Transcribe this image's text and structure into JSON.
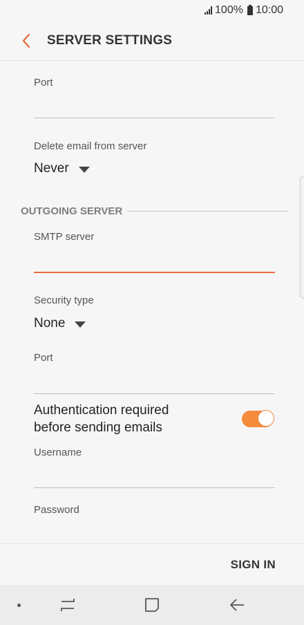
{
  "status_bar": {
    "battery": "100%",
    "time": "10:00"
  },
  "app_bar": {
    "title": "SERVER SETTINGS"
  },
  "incoming": {
    "port_label": "Port",
    "port_value": "",
    "delete_label": "Delete email from server",
    "delete_value": "Never"
  },
  "outgoing": {
    "section_title": "OUTGOING SERVER",
    "smtp_label": "SMTP server",
    "smtp_value": "",
    "security_label": "Security type",
    "security_value": "None",
    "port_label": "Port",
    "port_value": "",
    "auth_label_line1": "Authentication required",
    "auth_label_line2": "before sending emails",
    "auth_enabled": true,
    "username_label": "Username",
    "username_value": "",
    "password_label": "Password"
  },
  "actions": {
    "sign_in": "SIGN IN"
  },
  "colors": {
    "accent": "#f58b3c",
    "active_underline": "#e8693a",
    "back_arrow": "#e8693a"
  },
  "icons": {
    "back": "chevron-left-icon",
    "recent": "recent-apps-icon",
    "home": "home-icon",
    "nav_back": "back-arrow-icon"
  }
}
